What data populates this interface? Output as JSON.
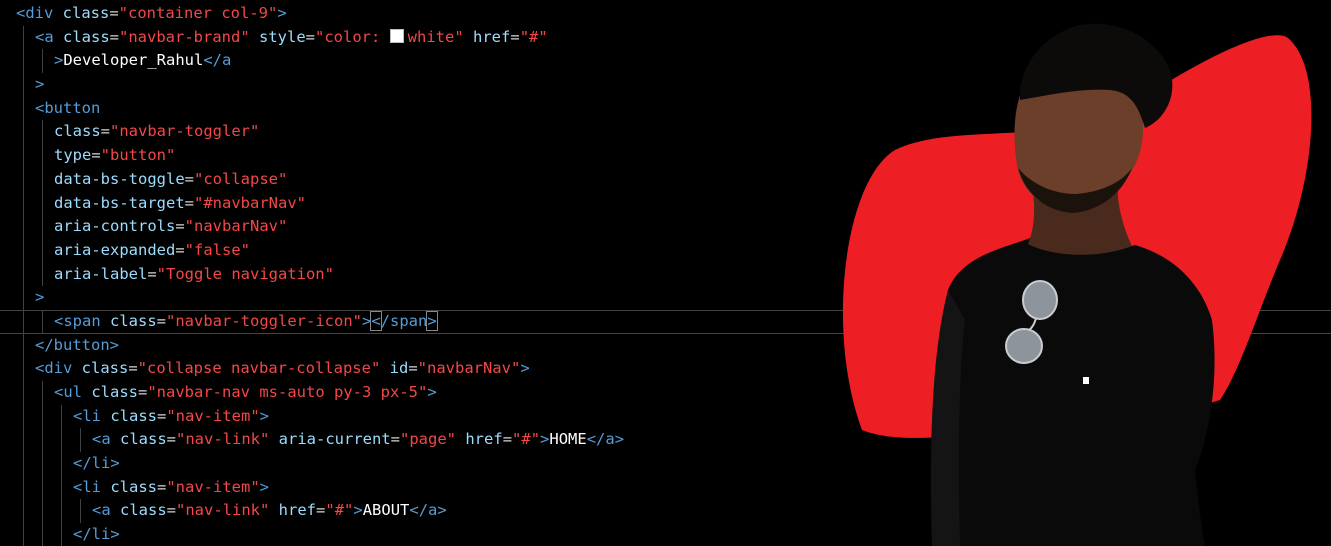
{
  "editor": {
    "lines": [
      {
        "indent": 0,
        "tokens": [
          [
            "tag",
            "<div"
          ],
          [
            "attr",
            " class"
          ],
          [
            "eq",
            "="
          ],
          [
            "str",
            "\"container col-9\""
          ],
          [
            "tag",
            ">"
          ]
        ]
      },
      {
        "indent": 1,
        "tokens": [
          [
            "tag",
            "<a"
          ],
          [
            "attr",
            " class"
          ],
          [
            "eq",
            "="
          ],
          [
            "str",
            "\"navbar-brand\""
          ],
          [
            "attr",
            " style"
          ],
          [
            "eq",
            "="
          ],
          [
            "str",
            "\"color: "
          ],
          [
            "swatch",
            ""
          ],
          [
            "str",
            "white\""
          ],
          [
            "attr",
            " href"
          ],
          [
            "eq",
            "="
          ],
          [
            "str",
            "\"#\""
          ]
        ]
      },
      {
        "indent": 2,
        "tokens": [
          [
            "tag",
            ">"
          ],
          [
            "text",
            "Developer_Rahul"
          ],
          [
            "tag",
            "</a"
          ]
        ]
      },
      {
        "indent": 1,
        "tokens": [
          [
            "tag",
            ">"
          ]
        ]
      },
      {
        "indent": 1,
        "tokens": [
          [
            "tag",
            "<button"
          ]
        ]
      },
      {
        "indent": 2,
        "tokens": [
          [
            "attr",
            "class"
          ],
          [
            "eq",
            "="
          ],
          [
            "str",
            "\"navbar-toggler\""
          ]
        ]
      },
      {
        "indent": 2,
        "tokens": [
          [
            "attr",
            "type"
          ],
          [
            "eq",
            "="
          ],
          [
            "str",
            "\"button\""
          ]
        ]
      },
      {
        "indent": 2,
        "tokens": [
          [
            "attr",
            "data-bs-toggle"
          ],
          [
            "eq",
            "="
          ],
          [
            "str",
            "\"collapse\""
          ]
        ]
      },
      {
        "indent": 2,
        "tokens": [
          [
            "attr",
            "data-bs-target"
          ],
          [
            "eq",
            "="
          ],
          [
            "str",
            "\"#navbarNav\""
          ]
        ]
      },
      {
        "indent": 2,
        "tokens": [
          [
            "attr",
            "aria-controls"
          ],
          [
            "eq",
            "="
          ],
          [
            "str",
            "\"navbarNav\""
          ]
        ]
      },
      {
        "indent": 2,
        "tokens": [
          [
            "attr",
            "aria-expanded"
          ],
          [
            "eq",
            "="
          ],
          [
            "str",
            "\"false\""
          ]
        ]
      },
      {
        "indent": 2,
        "tokens": [
          [
            "attr",
            "aria-label"
          ],
          [
            "eq",
            "="
          ],
          [
            "str",
            "\"Toggle navigation\""
          ]
        ]
      },
      {
        "indent": 1,
        "tokens": [
          [
            "tag",
            ">"
          ]
        ]
      },
      {
        "indent": 2,
        "current": true,
        "tokens": [
          [
            "tag",
            "<span"
          ],
          [
            "attr",
            " class"
          ],
          [
            "eq",
            "="
          ],
          [
            "str",
            "\"navbar-toggler-icon\""
          ],
          [
            "tag",
            ">"
          ],
          [
            "bracket",
            "<"
          ],
          [
            "tag",
            "/span"
          ],
          [
            "bracket",
            ">"
          ]
        ]
      },
      {
        "indent": 1,
        "tokens": [
          [
            "tag",
            "</button>"
          ]
        ]
      },
      {
        "indent": 1,
        "tokens": [
          [
            "tag",
            "<div"
          ],
          [
            "attr",
            " class"
          ],
          [
            "eq",
            "="
          ],
          [
            "str",
            "\"collapse navbar-collapse\""
          ],
          [
            "attr",
            " id"
          ],
          [
            "eq",
            "="
          ],
          [
            "str",
            "\"navbarNav\""
          ],
          [
            "tag",
            ">"
          ]
        ]
      },
      {
        "indent": 2,
        "tokens": [
          [
            "tag",
            "<ul"
          ],
          [
            "attr",
            " class"
          ],
          [
            "eq",
            "="
          ],
          [
            "str",
            "\"navbar-nav ms-auto py-3 px-5\""
          ],
          [
            "tag",
            ">"
          ]
        ]
      },
      {
        "indent": 3,
        "tokens": [
          [
            "tag",
            "<li"
          ],
          [
            "attr",
            " class"
          ],
          [
            "eq",
            "="
          ],
          [
            "str",
            "\"nav-item\""
          ],
          [
            "tag",
            ">"
          ]
        ]
      },
      {
        "indent": 4,
        "tokens": [
          [
            "tag",
            "<a"
          ],
          [
            "attr",
            " class"
          ],
          [
            "eq",
            "="
          ],
          [
            "str",
            "\"nav-link\""
          ],
          [
            "attr",
            " aria-current"
          ],
          [
            "eq",
            "="
          ],
          [
            "str",
            "\"page\""
          ],
          [
            "attr",
            " href"
          ],
          [
            "eq",
            "="
          ],
          [
            "str",
            "\"#\""
          ],
          [
            "tag",
            ">"
          ],
          [
            "text",
            "HOME"
          ],
          [
            "tag",
            "</a>"
          ]
        ]
      },
      {
        "indent": 3,
        "tokens": [
          [
            "tag",
            "</li>"
          ]
        ]
      },
      {
        "indent": 3,
        "tokens": [
          [
            "tag",
            "<li"
          ],
          [
            "attr",
            " class"
          ],
          [
            "eq",
            "="
          ],
          [
            "str",
            "\"nav-item\""
          ],
          [
            "tag",
            ">"
          ]
        ]
      },
      {
        "indent": 4,
        "tokens": [
          [
            "tag",
            "<a"
          ],
          [
            "attr",
            " class"
          ],
          [
            "eq",
            "="
          ],
          [
            "str",
            "\"nav-link\""
          ],
          [
            "attr",
            " href"
          ],
          [
            "eq",
            "="
          ],
          [
            "str",
            "\"#\""
          ],
          [
            "tag",
            ">"
          ],
          [
            "text",
            "ABOUT"
          ],
          [
            "tag",
            "</a>"
          ]
        ]
      },
      {
        "indent": 3,
        "tokens": [
          [
            "tag",
            "</li>"
          ]
        ]
      }
    ]
  },
  "colors": {
    "background": "#000000",
    "tag": "#569cd6",
    "attribute": "#9cdcfe",
    "string": "#f44747",
    "text": "#ffffff",
    "blob": "#ee1f24"
  },
  "photo": {
    "subject": "person-portrait",
    "icon": "person-photo-icon"
  }
}
